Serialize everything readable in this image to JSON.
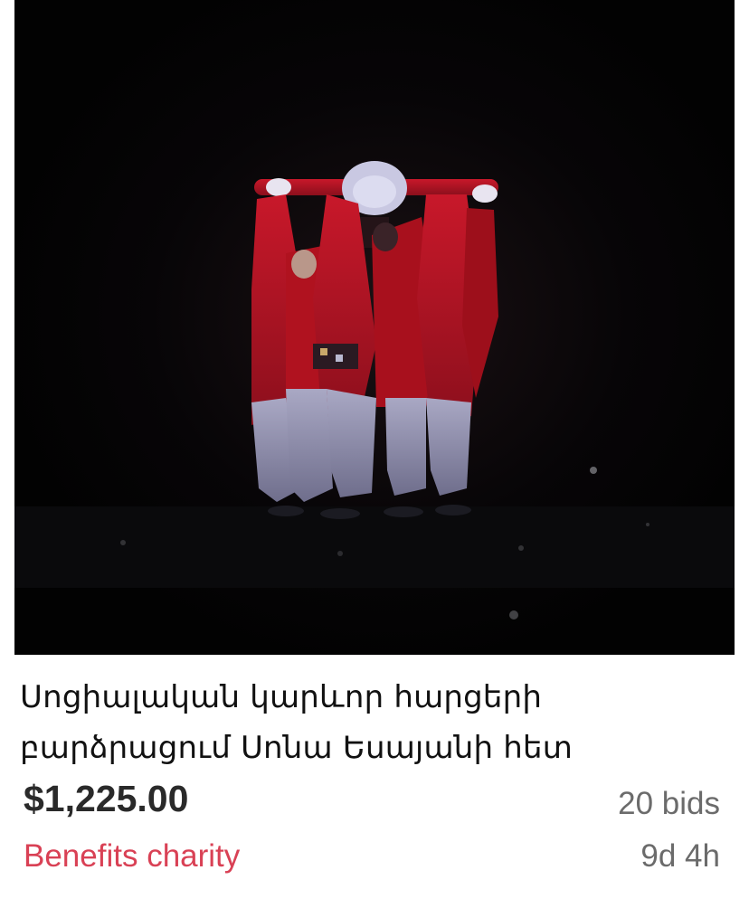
{
  "listing": {
    "title": "Սոցիալական կարևոր հարցերի բարձրացում Սոնա Եսայանի հետ",
    "price": "$1,225.00",
    "bids": "20 bids",
    "charity_label": "Benefits charity",
    "time_left": "9d 4h",
    "image_alt": "Dancers in red costumes performing on a dark stage"
  },
  "colors": {
    "price": "#2a2a2a",
    "meta_gray": "#6b6b6b",
    "charity_red": "#d94155",
    "image_background": "#050505"
  }
}
